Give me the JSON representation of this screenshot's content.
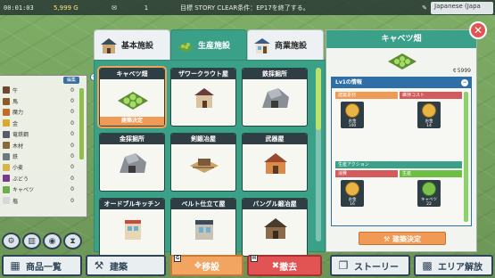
{
  "top_bar": {
    "clock": "00:01:03",
    "gold": "5,999 G",
    "count": "1",
    "goal": "目標 STORY CLEAR条件：EP17を終了する。",
    "language": "Japanese (Japa"
  },
  "resources": {
    "edit_label": "編集",
    "items": [
      {
        "name": "牛",
        "value": "0",
        "color": "#6b4a2b"
      },
      {
        "name": "馬",
        "value": "0",
        "color": "#8a5a2a"
      },
      {
        "name": "魔力",
        "value": "0",
        "color": "#c46a2a"
      },
      {
        "name": "金",
        "value": "0",
        "color": "#d9a92a"
      },
      {
        "name": "竜鉄鋼",
        "value": "0",
        "color": "#5a5a6a"
      },
      {
        "name": "木材",
        "value": "0",
        "color": "#8a6a3a"
      },
      {
        "name": "鉄",
        "value": "0",
        "color": "#707880"
      },
      {
        "name": "小麦",
        "value": "0",
        "color": "#d9b44a"
      },
      {
        "name": "ぶどう",
        "value": "0",
        "color": "#7a3a8a"
      },
      {
        "name": "キャベツ",
        "value": "0",
        "color": "#6ab04a"
      },
      {
        "name": "塩",
        "value": "0",
        "color": "#d8d8d8"
      }
    ]
  },
  "tabs": [
    {
      "label": "基本施設",
      "active": false
    },
    {
      "label": "生産施設",
      "active": true
    },
    {
      "label": "商業施設",
      "active": false
    }
  ],
  "cards": [
    {
      "title": "キャベツ畑",
      "badge": "建築決定",
      "selected": true,
      "img": "cabbage"
    },
    {
      "title": "ザワークラウト屋",
      "badge": "",
      "selected": false,
      "img": "house"
    },
    {
      "title": "鉄採掘所",
      "badge": "",
      "selected": false,
      "img": "rock"
    },
    {
      "title": "金採掘所",
      "badge": "",
      "selected": false,
      "img": "rock"
    },
    {
      "title": "剣鍛冶屋",
      "badge": "",
      "selected": false,
      "img": "yard"
    },
    {
      "title": "武器屋",
      "badge": "",
      "selected": false,
      "img": "barn"
    },
    {
      "title": "オードブルキッチン",
      "badge": "",
      "selected": false,
      "img": "shop"
    },
    {
      "title": "ベルト仕立て屋",
      "badge": "",
      "selected": false,
      "img": "shop2"
    },
    {
      "title": "バングル鍛冶屋",
      "badge": "",
      "selected": false,
      "img": "cabin"
    }
  ],
  "detail": {
    "title": "キャベツ畑",
    "price": "5999",
    "info_title": "Lv1の情報",
    "build_materials_label": "建築素材",
    "maintenance_label": "維持コスト",
    "material_item": {
      "name": "お金",
      "amount": "100"
    },
    "maintenance_item": {
      "name": "お金",
      "amount": "14"
    },
    "production_label": "生産アクション",
    "consume_label": "消費",
    "produce_label": "生産",
    "consume_item": {
      "name": "お金",
      "amount": "16"
    },
    "produce_item": {
      "name": "キャベツ",
      "amount": "22"
    },
    "confirm_label": "建築決定"
  },
  "toolbar": {
    "items_label": "商品一覧",
    "build_label": "建築",
    "move_label": "移設",
    "move_key": "G",
    "remove_label": "撤去",
    "remove_key": "H",
    "story_label": "ストーリー",
    "area_label": "エリア解放"
  }
}
